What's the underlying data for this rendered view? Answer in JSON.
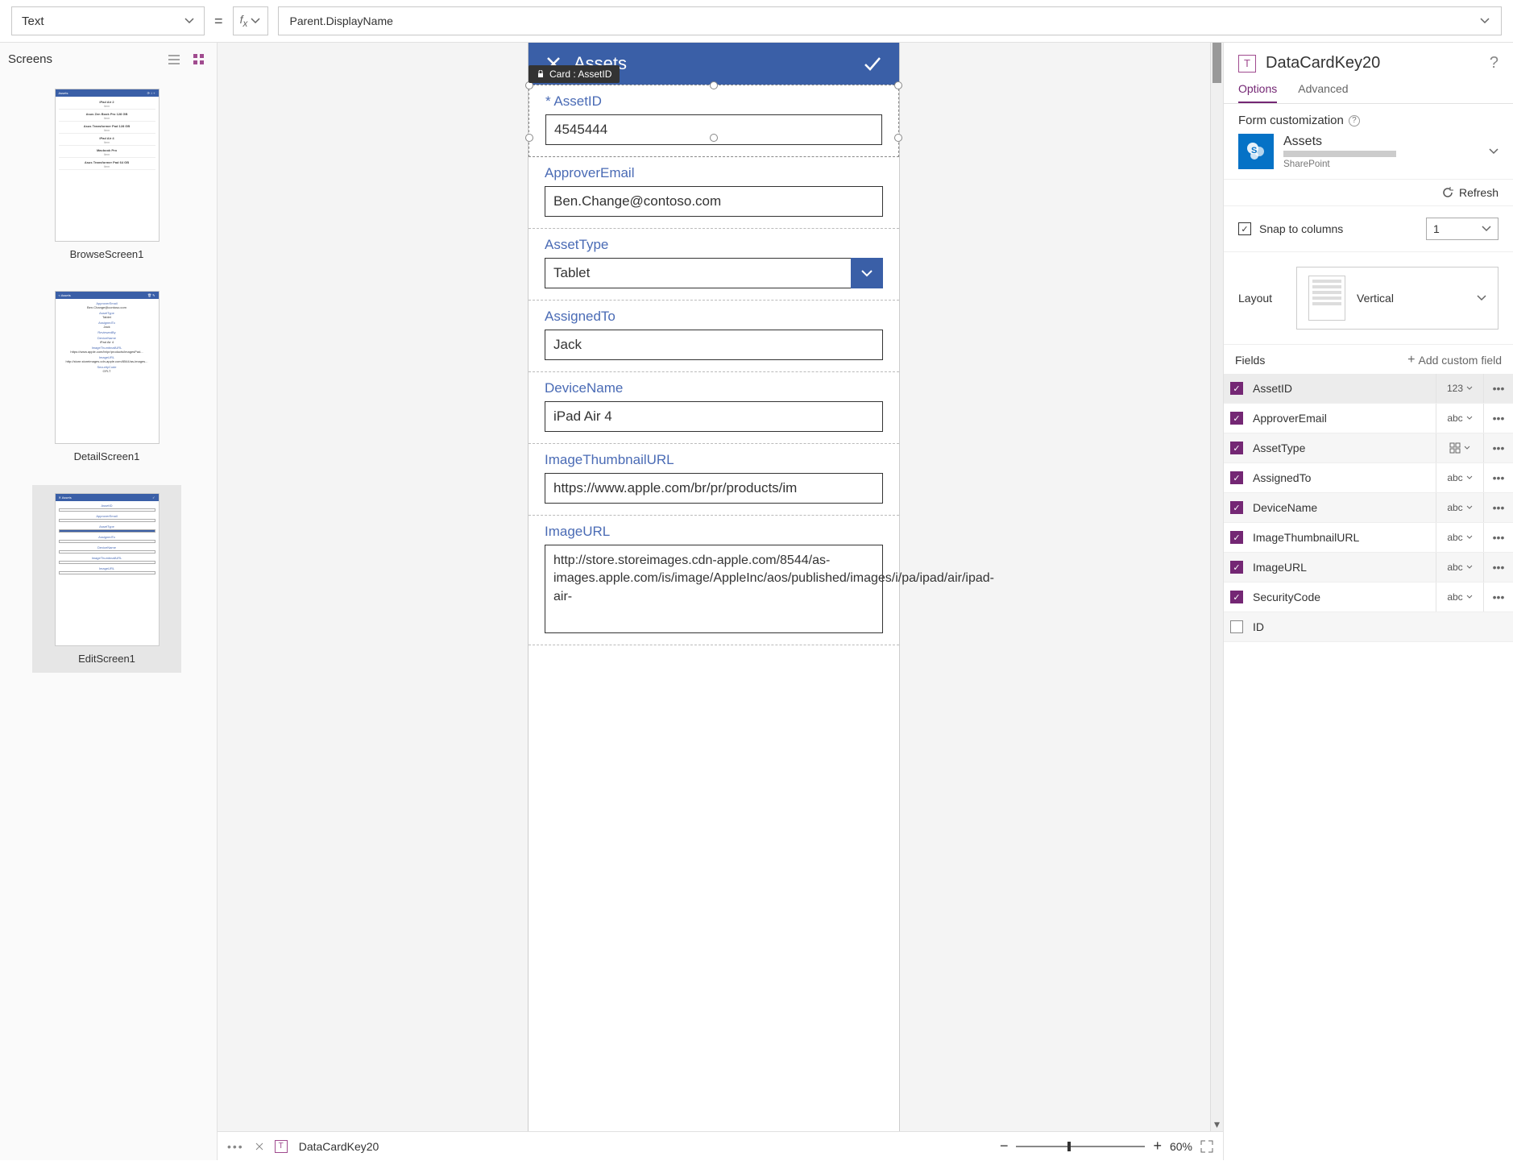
{
  "topbar": {
    "property": "Text",
    "equals": "=",
    "fx": "fx",
    "formula": "Parent.DisplayName"
  },
  "tree": {
    "title": "Screens",
    "screens": [
      {
        "name": "BrowseScreen1"
      },
      {
        "name": "DetailScreen1"
      },
      {
        "name": "EditScreen1"
      }
    ],
    "selectedIndex": 2
  },
  "canvas": {
    "appTitle": "Assets",
    "selectedCardTooltip": "Card : AssetID",
    "cards": [
      {
        "label": "AssetID",
        "required": true,
        "value": "4545444",
        "type": "text",
        "selected": true
      },
      {
        "label": "ApproverEmail",
        "value": "Ben.Change@contoso.com",
        "type": "text"
      },
      {
        "label": "AssetType",
        "value": "Tablet",
        "type": "select"
      },
      {
        "label": "AssignedTo",
        "value": "Jack",
        "type": "text"
      },
      {
        "label": "DeviceName",
        "value": "iPad Air 4",
        "type": "text"
      },
      {
        "label": "ImageThumbnailURL",
        "value": "https://www.apple.com/br/pr/products/im",
        "type": "text"
      },
      {
        "label": "ImageURL",
        "value": "http://store.storeimages.cdn-apple.com/8544/as-images.apple.com/is/image/AppleInc/aos/published/images/i/pa/ipad/air/ipad-air-",
        "type": "multiline"
      }
    ]
  },
  "statusbar": {
    "breadcrumb": "DataCardKey20",
    "zoom": "60%"
  },
  "right": {
    "title": "DataCardKey20",
    "tabs": {
      "options": "Options",
      "advanced": "Advanced",
      "active": "options"
    },
    "formCustomization": "Form customization",
    "dataSource": {
      "name": "Assets",
      "connector": "SharePoint"
    },
    "refresh": "Refresh",
    "snap": {
      "label": "Snap to columns",
      "checked": true,
      "columns": "1"
    },
    "layout": {
      "label": "Layout",
      "value": "Vertical"
    },
    "fieldsHeader": "Fields",
    "addCustom": "Add custom field",
    "fields": [
      {
        "name": "AssetID",
        "checked": true,
        "type": "123",
        "selected": true
      },
      {
        "name": "ApproverEmail",
        "checked": true,
        "type": "abc"
      },
      {
        "name": "AssetType",
        "checked": true,
        "type": "grid"
      },
      {
        "name": "AssignedTo",
        "checked": true,
        "type": "abc"
      },
      {
        "name": "DeviceName",
        "checked": true,
        "type": "abc"
      },
      {
        "name": "ImageThumbnailURL",
        "checked": true,
        "type": "abc"
      },
      {
        "name": "ImageURL",
        "checked": true,
        "type": "abc"
      },
      {
        "name": "SecurityCode",
        "checked": true,
        "type": "abc"
      },
      {
        "name": "ID",
        "checked": false,
        "type": ""
      }
    ]
  },
  "thumb_content": {
    "browse": {
      "title": "Assets",
      "items": [
        "iPad Air 2",
        "Asus Zen Book Pro 128 GB",
        "Asus Transformer Pad 128 GB",
        "iPad Air 4",
        "Macbook Pro",
        "Asus Transformer Pad 64 GB"
      ]
    },
    "detail": {
      "title": "Assets",
      "rows": [
        [
          "ApproverEmail",
          "Ben.Change@contoso.com"
        ],
        [
          "AssetType",
          "Tablet"
        ],
        [
          "AssignedTo",
          "Jack"
        ],
        [
          "ReviewedBy",
          ""
        ],
        [
          "DeviceName",
          "iPad Air 4"
        ],
        [
          "ImageThumbnailURL",
          "https://www.apple.com/br/pr/products/imagesPad..."
        ],
        [
          "ImageURL",
          "http://store.storeimages.cdn-apple.com/8544/as-images..."
        ],
        [
          "SecurityCode",
          "GFLT"
        ]
      ]
    },
    "edit": {
      "title": "Assets",
      "rows": [
        [
          "AssetID",
          "4545444"
        ],
        [
          "ApproverEmail",
          "Ben.Change@contoso.com"
        ],
        [
          "AssetType",
          "Tablet"
        ],
        [
          "AssignedTo",
          "Jack"
        ],
        [
          "DeviceName",
          "iPad Air 4"
        ],
        [
          "ImageThumbnailURL",
          "https://www.apple.com/br/pr/products/..."
        ],
        [
          "ImageURL",
          "http://store.storeimages.cdn-apple.com/8544/..."
        ]
      ]
    }
  }
}
